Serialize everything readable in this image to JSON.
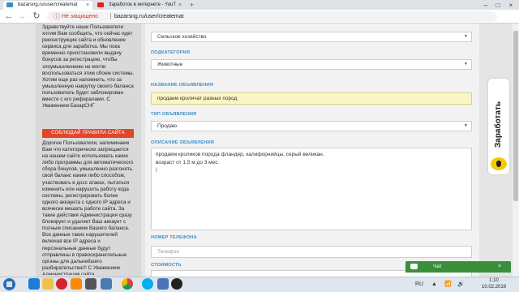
{
  "tabs": [
    {
      "title": "bazarsng.ru/user/createmat",
      "close": "×"
    },
    {
      "title": "Заработок в интернете - YouT",
      "close": "×"
    }
  ],
  "new_tab": "+",
  "window_controls": {
    "minimize": "–",
    "maximize": "□",
    "close": "×"
  },
  "nav": {
    "back": "←",
    "forward": "→",
    "reload": "↻"
  },
  "address": {
    "security_icon": "ⓘ",
    "security_label": "Не защищено",
    "url": "bazarsng.ru/user/createmat"
  },
  "sidebar": {
    "notice_text": "Здравствуйте наши Пользователи хотим Вам сообщить, что сейчас идет реконструкция сайта и обновление сервиса для заработка. Мы пока временно приостановили выдачу бонусов за регистрацию, чтобы злоумышленники не могли воспользоваться этим сбоем системы. Хотим еще раз напомнить, что за умышленную накрутку своего баланса пользователь будет заблокирован вместе с его рефералами. С Уважением БазарСНГ",
    "rules_button": "СОБЛЮДАЙ ПРАВИЛА САЙТА",
    "rules_text": "Дорогие Пользователи, напоминаем Вам что категорически запрещается на нашем сайте использовать какие либо программы для автоматического сбора бонусов, умышленно разгонять свой баланс каким либо способом, участвовать в досс атаках, пытаться изменить или нарушить работу кода системы, регистрировать более одного аккаунта с одного IP адреса и всячески мешать работе сайта. За такие действия Администрация сразу блокирует и удаляет Ваш аккаунт с полным списанием Вашего баланса. Все данные таких нарушителей включая все IP адреса и персональные данные будут отправлены в правоохранительные органы для дальнейшего разбирательства!!! С Уважением Администрация сайта"
  },
  "form": {
    "category_value": "Сельское хозяйство",
    "subcategory_label": "ПОДКАТЕГОРИЯ",
    "subcategory_value": "Животные",
    "title_label": "НАЗВАНИЕ ОБЪЯВЛЕНИЯ",
    "title_value": "продаем кроличат разных пород",
    "type_label": "ТИП ОБЪЯВЛЕНИЯ",
    "type_value": "Продаю",
    "description_label": "ОПИСАНИЕ ОБЪЯВЛЕНИЯ",
    "description_line1": "продаем кроликов порода фландер, калифорнийцы, серый великан.",
    "description_line2": "возраст от 1.5 м до 3 мес",
    "description_line3": "|",
    "phone_label": "НОМЕР ТЕЛЕФОНА",
    "phone_placeholder": "Телефон",
    "price_label": "СТОИМОСТЬ",
    "dropdown_caret": "▼"
  },
  "earn_badge": {
    "label": "Заработать"
  },
  "chat": {
    "label": "Чат",
    "close": "×"
  },
  "clock": {
    "time": "1:10",
    "date": "10.02.2019"
  },
  "tray": {
    "lang": "RU",
    "flag": "▲",
    "volume": "🔊",
    "network": "📶"
  },
  "colors": {
    "accent_blue": "#3a8dc8",
    "rules_red": "#e2462a",
    "title_yellow": "#f9f6c4",
    "chat_green": "#3a8f3a"
  },
  "taskbar_icons": [
    "start-icon",
    "ie-icon",
    "folder-icon",
    "opera-icon",
    "media-icon",
    "chrome-icon",
    "skype-icon",
    "window-icon",
    "word-icon",
    "bandicam-icon"
  ]
}
